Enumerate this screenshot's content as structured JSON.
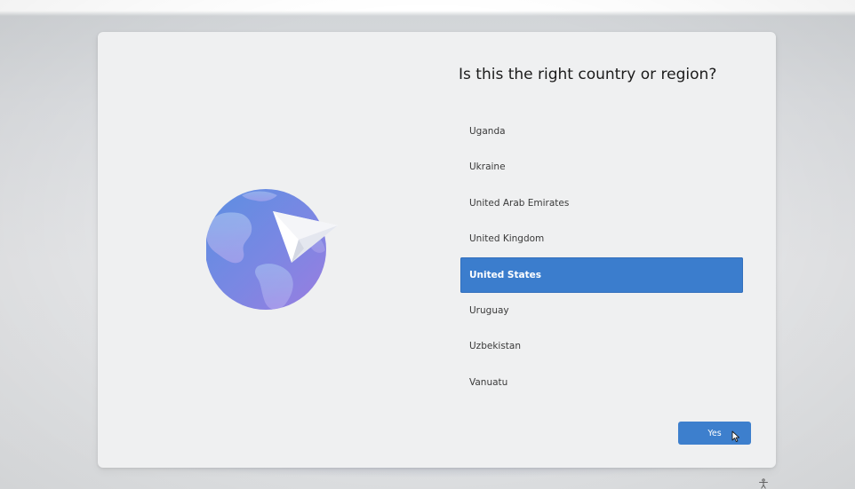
{
  "setup": {
    "title": "Is this the right country or region?",
    "countries": [
      "Uganda",
      "Ukraine",
      "United Arab Emirates",
      "United Kingdom",
      "United States",
      "Uruguay",
      "Uzbekistan",
      "Vanuatu"
    ],
    "selected_country": "United States",
    "yes_label": "Yes"
  },
  "icons": {
    "illustration": "globe-with-paper-plane-icon",
    "cursor": "mouse-pointer-icon",
    "ease_of_access": "accessibility-icon"
  },
  "colors": {
    "accent": "#3b7dcd",
    "card_background": "#eff0f1",
    "globe_purple": "#8a86e3",
    "globe_blue": "#5e8fe0"
  }
}
